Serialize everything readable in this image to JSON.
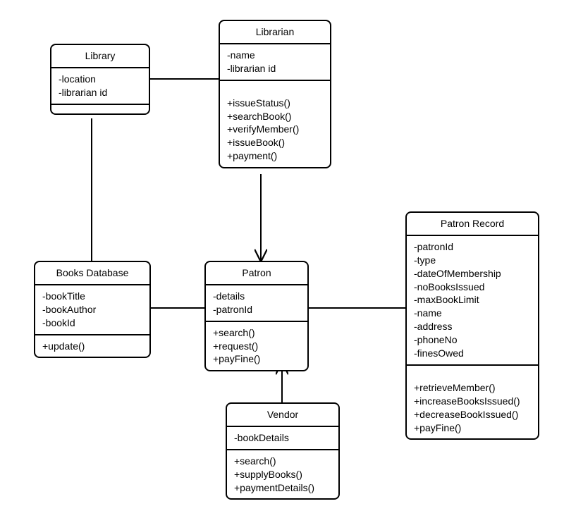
{
  "classes": {
    "library": {
      "title": "Library",
      "attrs": [
        "-location",
        "-librarian id"
      ],
      "ops": []
    },
    "librarian": {
      "title": "Librarian",
      "attrs": [
        "-name",
        "-librarian id"
      ],
      "ops": [
        "+issueStatus()",
        "+searchBook()",
        "+verifyMember()",
        "+issueBook()",
        "+payment()"
      ]
    },
    "booksdb": {
      "title": "Books Database",
      "attrs": [
        "-bookTitle",
        "-bookAuthor",
        "-bookId"
      ],
      "ops": [
        "+update()"
      ]
    },
    "patron": {
      "title": "Patron",
      "attrs": [
        "-details",
        "-patronId"
      ],
      "ops": [
        "+search()",
        "+request()",
        "+payFine()"
      ]
    },
    "patronrecord": {
      "title": "Patron Record",
      "attrs": [
        "-patronId",
        "-type",
        "-dateOfMembership",
        "-noBooksIssued",
        "-maxBookLimit",
        "-name",
        "-address",
        "-phoneNo",
        "-finesOwed"
      ],
      "ops": [
        "+retrieveMember()",
        "+increaseBooksIssued()",
        "+decreaseBookIssued()",
        "+payFine()"
      ]
    },
    "vendor": {
      "title": "Vendor",
      "attrs": [
        "-bookDetails"
      ],
      "ops": [
        "+search()",
        "+supplyBooks()",
        "+paymentDetails()"
      ]
    }
  }
}
